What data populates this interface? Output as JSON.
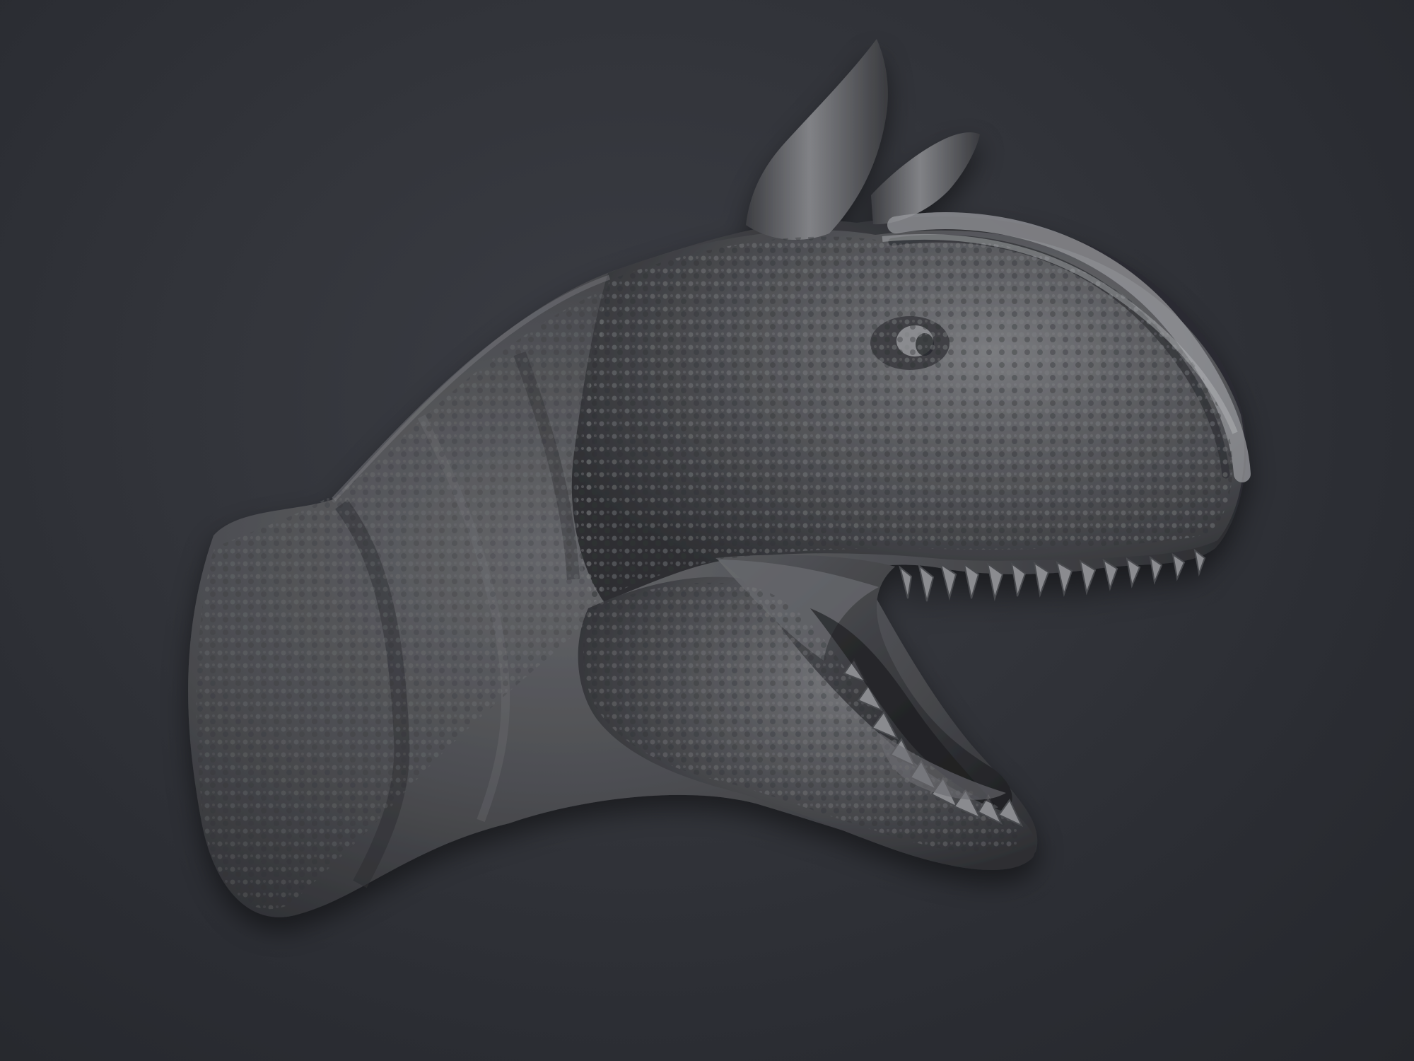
{
  "scene": {
    "subject": "sculpted-dinosaur-head",
    "background_color": "#2f3137",
    "model_color": "#5a5b5e",
    "highlight_color": "#b9babd",
    "shadow_color": "#202125"
  }
}
